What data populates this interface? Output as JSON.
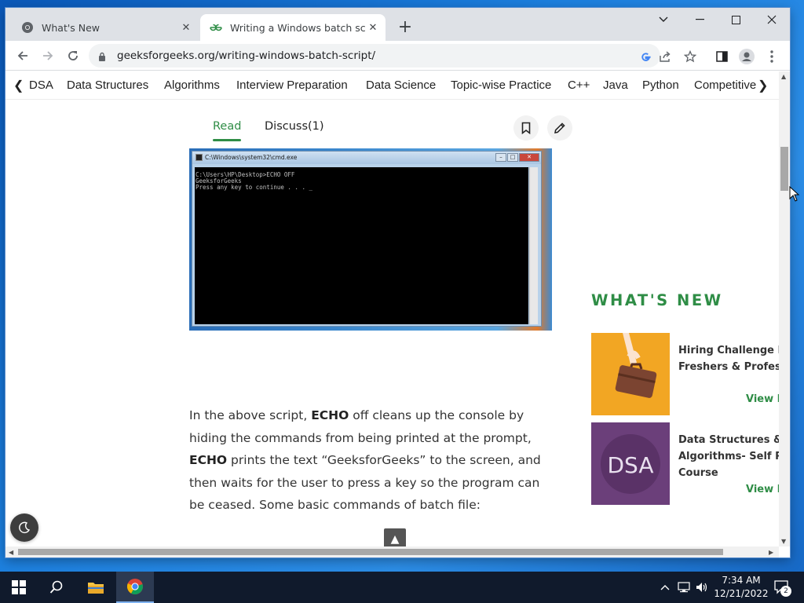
{
  "browser": {
    "tabs": [
      {
        "title": "What's New",
        "active": false,
        "icon": "chrome-icon"
      },
      {
        "title": "Writing a Windows batch script - GeeksforGeeks",
        "active": true,
        "icon": "gfg-icon"
      }
    ],
    "new_tab_label": "+",
    "url": "geeksforgeeks.org/writing-windows-batch-script/"
  },
  "nav": {
    "items": [
      "DSA",
      "Data Structures",
      "Algorithms",
      "Interview Preparation",
      "Data Science",
      "Topic-wise Practice",
      "C++",
      "Java",
      "Python",
      "Competitive"
    ]
  },
  "article": {
    "tabs": {
      "read": "Read",
      "discuss": "Discuss(1)"
    },
    "cmd": {
      "title": "C:\\Windows\\system32\\cmd.exe",
      "lines": [
        "C:\\Users\\HP\\Desktop>ECHO OFF",
        "GeeksforGeeks",
        "Press any key to continue . . . _"
      ]
    },
    "paragraph": {
      "p1": "In the above script, ",
      "b1": "ECHO",
      "p2": " off cleans up the console by hiding the commands from being printed at the prompt, ",
      "b2": "ECHO",
      "p3": " prints the text “GeeksforGeeks” to the screen, and then waits for the user to press a key so the program can be ceased. Some basic commands of batch file:"
    }
  },
  "sidebar": {
    "title": "WHAT'S NEW",
    "cards": [
      {
        "title_line1": "Hiring Challenge For",
        "title_line2": "Freshers & Professionals",
        "title_line3": "",
        "view": "View Details",
        "thumb_text": ""
      },
      {
        "title_line1": "Data Structures &",
        "title_line2": "Algorithms- Self Paced",
        "title_line3": "Course",
        "view": "View Details",
        "thumb_text": "DSA"
      }
    ]
  },
  "colors": {
    "gfg_green": "#2f8d46",
    "thumb1_bg": "#f2a623",
    "thumb2_bg": "#6b3f7a"
  },
  "taskbar": {
    "time": "7:34 AM",
    "date": "12/21/2022",
    "notification_count": "2"
  }
}
